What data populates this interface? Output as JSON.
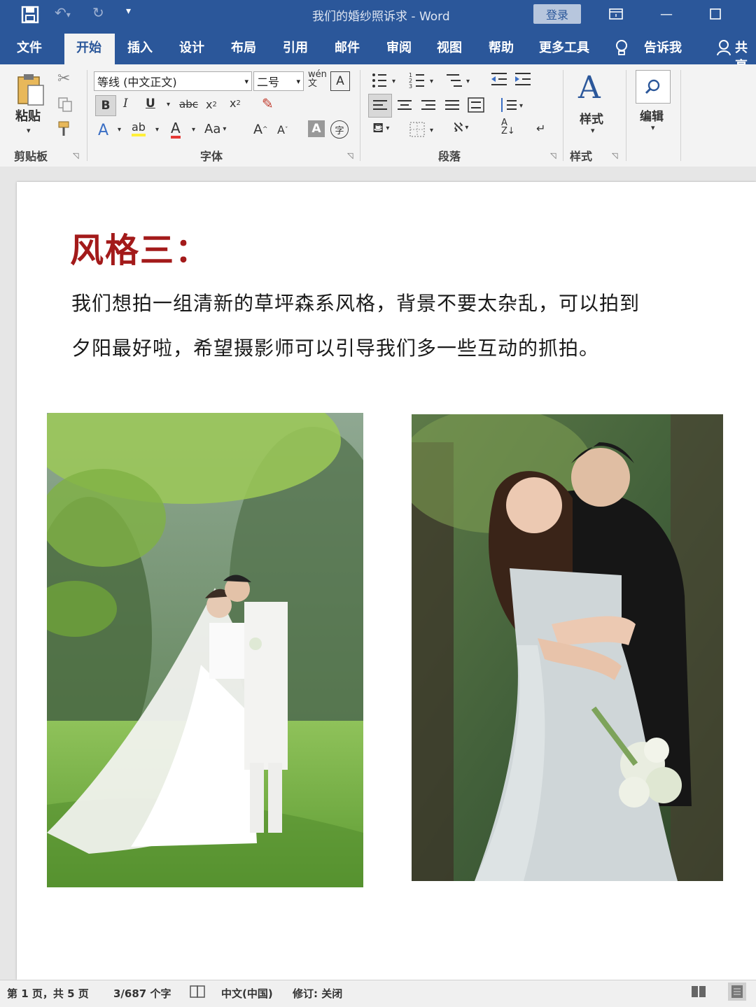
{
  "window": {
    "title": "我们的婚纱照诉求 - Word",
    "login_label": "登录",
    "colors": {
      "brand": "#2b579a",
      "heading_red": "#a31a1a"
    }
  },
  "tabs": [
    {
      "label": "文件"
    },
    {
      "label": "开始",
      "active": true
    },
    {
      "label": "插入"
    },
    {
      "label": "设计"
    },
    {
      "label": "布局"
    },
    {
      "label": "引用"
    },
    {
      "label": "邮件"
    },
    {
      "label": "审阅"
    },
    {
      "label": "视图"
    },
    {
      "label": "帮助"
    },
    {
      "label": "更多工具"
    },
    {
      "label": "告诉我"
    },
    {
      "label": "共享"
    }
  ],
  "ribbon": {
    "clipboard": {
      "paste_label": "粘贴",
      "group_label": "剪贴板"
    },
    "font": {
      "font_name": "等线 (中文正文)",
      "font_size": "二号",
      "group_label": "字体",
      "aa_label": "Aa"
    },
    "paragraph": {
      "group_label": "段落"
    },
    "styles": {
      "styles_label": "样式",
      "group_label": "样式"
    },
    "editing": {
      "edit_label": "编辑"
    }
  },
  "document": {
    "heading": "风格三：",
    "body_line1": "我们想拍一组清新的草坪森系风格，背景不要太杂乱，可以拍到",
    "body_line2": "夕阳最好啦，希望摄影师可以引导我们多一些互动的抓拍。"
  },
  "statusbar": {
    "page_info": "第 1 页，共 5 页",
    "word_count": "3/687 个字",
    "language": "中文(中国)",
    "track_changes": "修订: 关闭"
  }
}
